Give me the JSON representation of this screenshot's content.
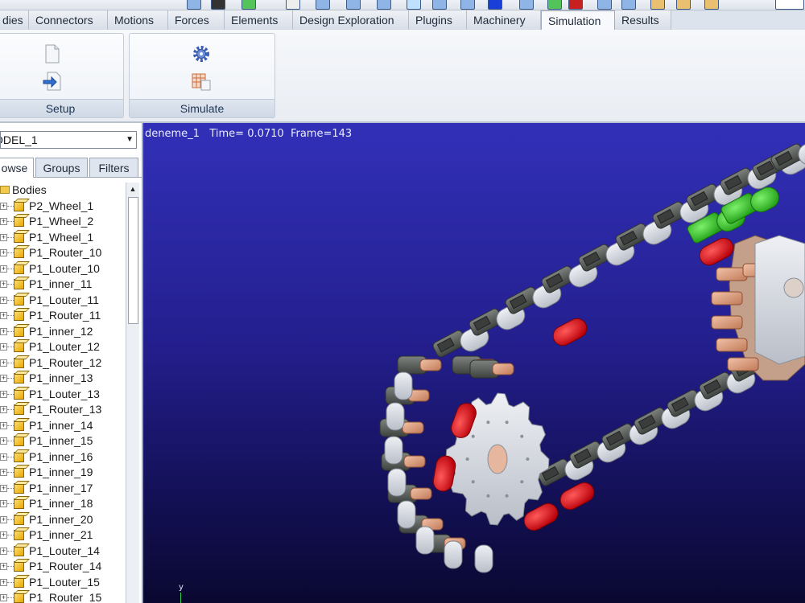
{
  "ribbon": {
    "tabs": [
      {
        "label": "dies",
        "active": false
      },
      {
        "label": "Connectors",
        "active": false
      },
      {
        "label": "Motions",
        "active": false
      },
      {
        "label": "Forces",
        "active": false
      },
      {
        "label": "Elements",
        "active": false
      },
      {
        "label": "Design Exploration",
        "active": false
      },
      {
        "label": "Plugins",
        "active": false
      },
      {
        "label": "Machinery",
        "active": false
      },
      {
        "label": "Simulation",
        "active": true
      },
      {
        "label": "Results",
        "active": false
      }
    ],
    "groups": {
      "setup": {
        "label": "Setup",
        "icons": [
          "document-icon",
          "import-arrow-icon"
        ]
      },
      "simulate": {
        "label": "Simulate",
        "icons": [
          "gear-icon",
          "table-icon"
        ]
      }
    }
  },
  "left_panel": {
    "model_select": {
      "value": "ODEL_1"
    },
    "tabs": [
      {
        "label": "owse",
        "active": true
      },
      {
        "label": "Groups",
        "active": false
      },
      {
        "label": "Filters",
        "active": false
      }
    ],
    "tree": {
      "root": "Bodies",
      "items": [
        "P2_Wheel_1",
        "P1_Wheel_2",
        "P1_Wheel_1",
        "P1_Router_10",
        "P1_Louter_10",
        "P1_inner_11",
        "P1_Louter_11",
        "P1_Router_11",
        "P1_inner_12",
        "P1_Louter_12",
        "P1_Router_12",
        "P1_inner_13",
        "P1_Louter_13",
        "P1_Router_13",
        "P1_inner_14",
        "P1_inner_15",
        "P1_inner_16",
        "P1_inner_19",
        "P1_inner_17",
        "P1_inner_18",
        "P1_inner_20",
        "P1_inner_21",
        "P1_Louter_14",
        "P1_Router_14",
        "P1_Louter_15",
        "P1_Router_15"
      ]
    }
  },
  "viewport": {
    "model_name": "deneme_1",
    "time_label": "Time=",
    "time_value": "0.0710",
    "frame_label": "Frame=",
    "frame_value": "143",
    "axis_label": "y",
    "colors": {
      "background_top": "#3230b8",
      "background_bottom": "#0a0830",
      "link_plate": "#d9dde4",
      "link_block": "#5a5f5c",
      "roller": "#e0a58a",
      "highlight_red": "#e0141c",
      "highlight_green": "#3ccf2a"
    }
  }
}
